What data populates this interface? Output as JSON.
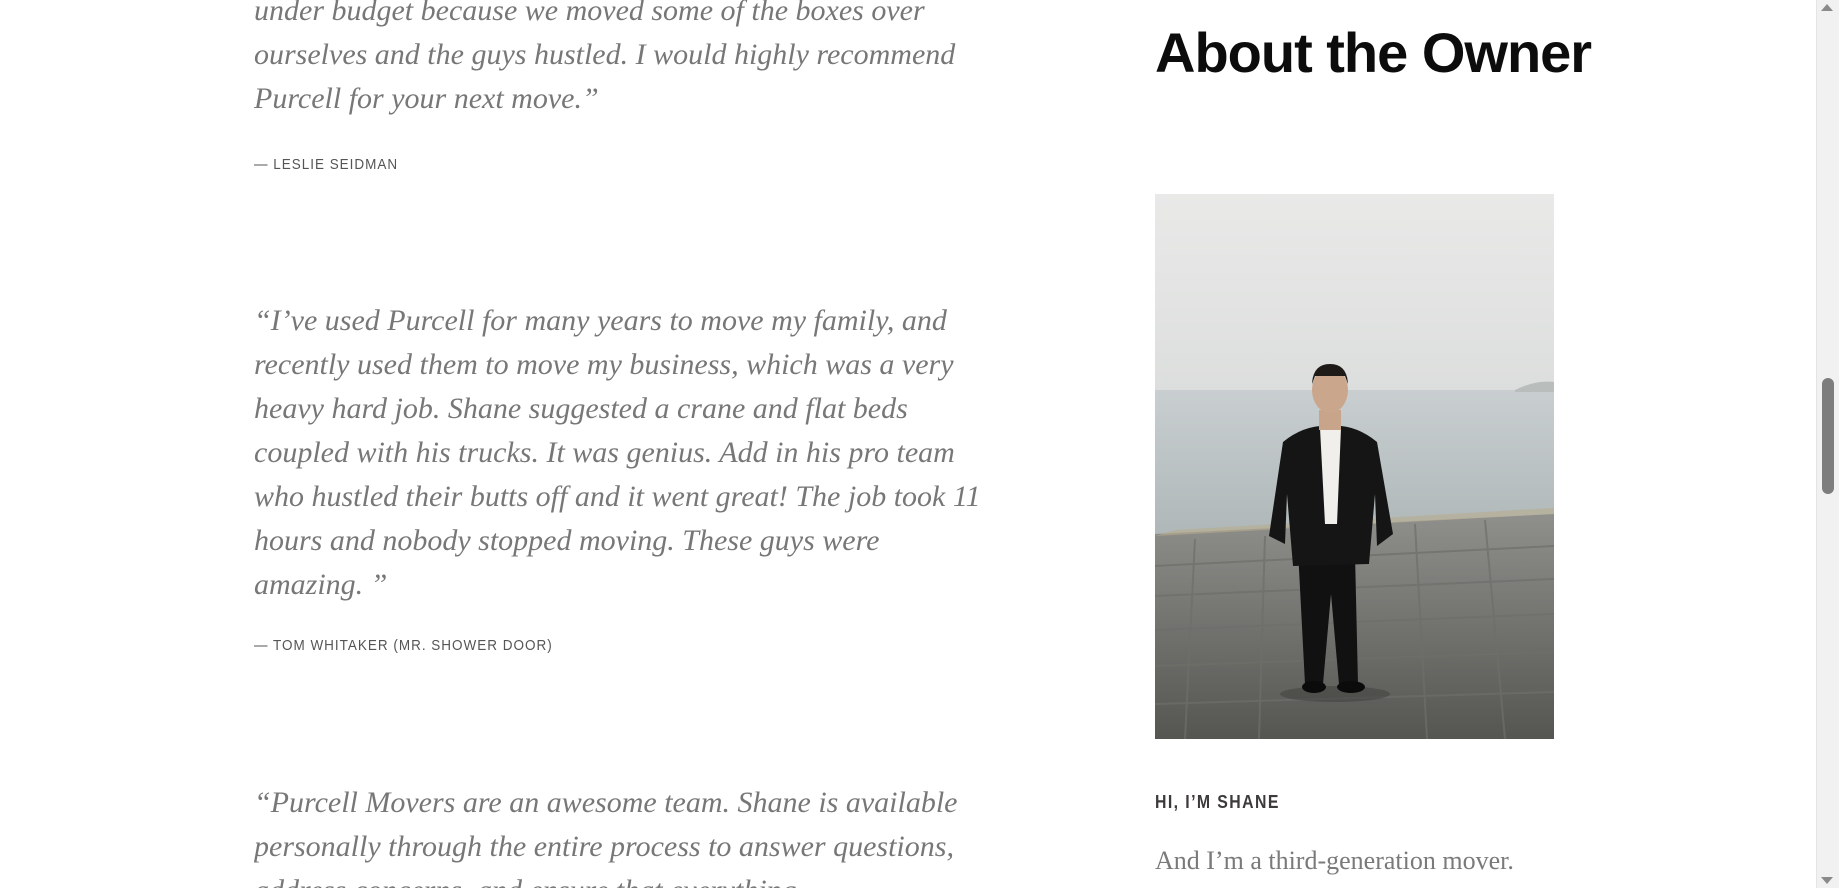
{
  "testimonials": [
    {
      "quote": "under budget because we moved some of the boxes over ourselves and the guys hustled. I would highly recommend Purcell for your next move.”",
      "author": "— LESLIE SEIDMAN"
    },
    {
      "quote": "“I’ve used Purcell for many years to move my family, and recently used them to move my business, which was a very heavy hard job. Shane suggested a crane and flat beds coupled with his trucks. It was genius. Add in his pro team who hustled their butts off and it went great! The job took 11 hours and nobody stopped moving. These guys were amazing. ”",
      "author": "— TOM WHITAKER (MR. SHOWER DOOR)"
    },
    {
      "quote": "“Purcell Movers are an awesome team. Shane is available personally through the entire process to answer questions, address concerns, and ensure that everything"
    }
  ],
  "about": {
    "title": "About the Owner",
    "greeting": "HI, I’M SHANE",
    "intro": "And I’m a third-generation mover."
  }
}
